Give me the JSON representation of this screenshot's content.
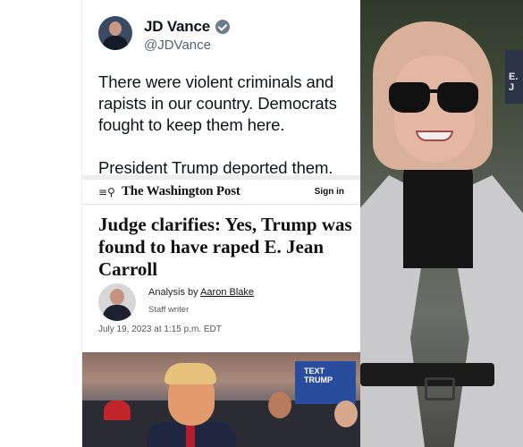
{
  "tweet": {
    "display_name": "JD Vance",
    "handle": "@JDVance",
    "text": "There were violent criminals and rapists in our country. Democrats fought to keep them here.\n\nPresident Trump deported them."
  },
  "article": {
    "menu_icon": "menu-search-icon",
    "masthead": "The Washington Post",
    "signin_label": "Sign in",
    "headline": "Judge clarifies: Yes, Trump was found to have raped E. Jean Carroll",
    "analysis_prefix": "Analysis by ",
    "author": "Aaron Blake",
    "author_title": "Staff writer",
    "timestamp": "July 19, 2023 at 1:15 p.m. EDT"
  },
  "photo_right": {
    "sign_text": "E. J"
  },
  "photo_bottom": {
    "sign_text": "TEXT\nTRUMP"
  },
  "colors": {
    "verified_badge": "#6b7c8f",
    "tweet_text": "#0f1419",
    "handle": "#536471"
  }
}
